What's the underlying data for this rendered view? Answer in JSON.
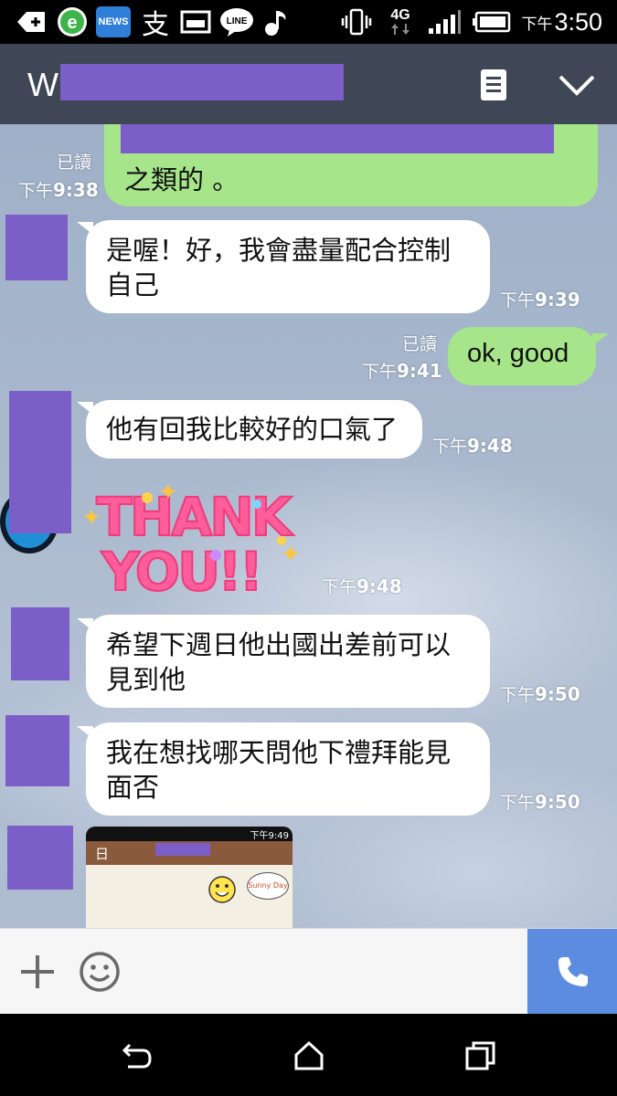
{
  "status_bar": {
    "time_prefix": "下午",
    "time": "3:50",
    "news_label": "NEWS",
    "zhi_label": "支",
    "line_label": "LINE",
    "network": "4G"
  },
  "header": {
    "title_visible": "W",
    "title_redacted": true
  },
  "messages": [
    {
      "id": "m1",
      "side": "out",
      "text": "之類的 。",
      "read": "已讀",
      "time_prefix": "下午",
      "time": "9:38"
    },
    {
      "id": "m2",
      "side": "in",
      "text": "是喔！好，我會盡量配合控制\n自己",
      "time_prefix": "下午",
      "time": "9:39"
    },
    {
      "id": "m3",
      "side": "out",
      "text": "ok, good",
      "read": "已讀",
      "time_prefix": "下午",
      "time": "9:41"
    },
    {
      "id": "m4",
      "side": "in",
      "text": "他有回我比較好的口氣了",
      "time_prefix": "下午",
      "time": "9:48"
    },
    {
      "id": "m5",
      "side": "in",
      "sticker": "THANK YOU!!",
      "sticker_line1": "THANK",
      "sticker_line2": "YOU!!",
      "time_prefix": "下午",
      "time": "9:48"
    },
    {
      "id": "m6",
      "side": "in",
      "text": "希望下週日他出國出差前可以\n見到他",
      "time_prefix": "下午",
      "time": "9:50"
    },
    {
      "id": "m7",
      "side": "in",
      "text": "我在想找哪天問他下禮拜能見\n面否",
      "time_prefix": "下午",
      "time": "9:50"
    },
    {
      "id": "m8",
      "side": "in",
      "image": "screenshot-thumbnail",
      "thumb_time": "下午9:49",
      "thumb_tab": "日",
      "thumb_sticker_text": "Sunny Day"
    }
  ],
  "input_bar": {
    "plus_icon": "plus-icon",
    "emoji_icon": "smiley-icon",
    "call_icon": "phone-icon"
  },
  "colors": {
    "header_bg": "#3f4656",
    "bubble_out": "#a6e58a",
    "bubble_in": "#ffffff",
    "redaction": "#7b5ec8",
    "call_button": "#5b8ce0"
  }
}
